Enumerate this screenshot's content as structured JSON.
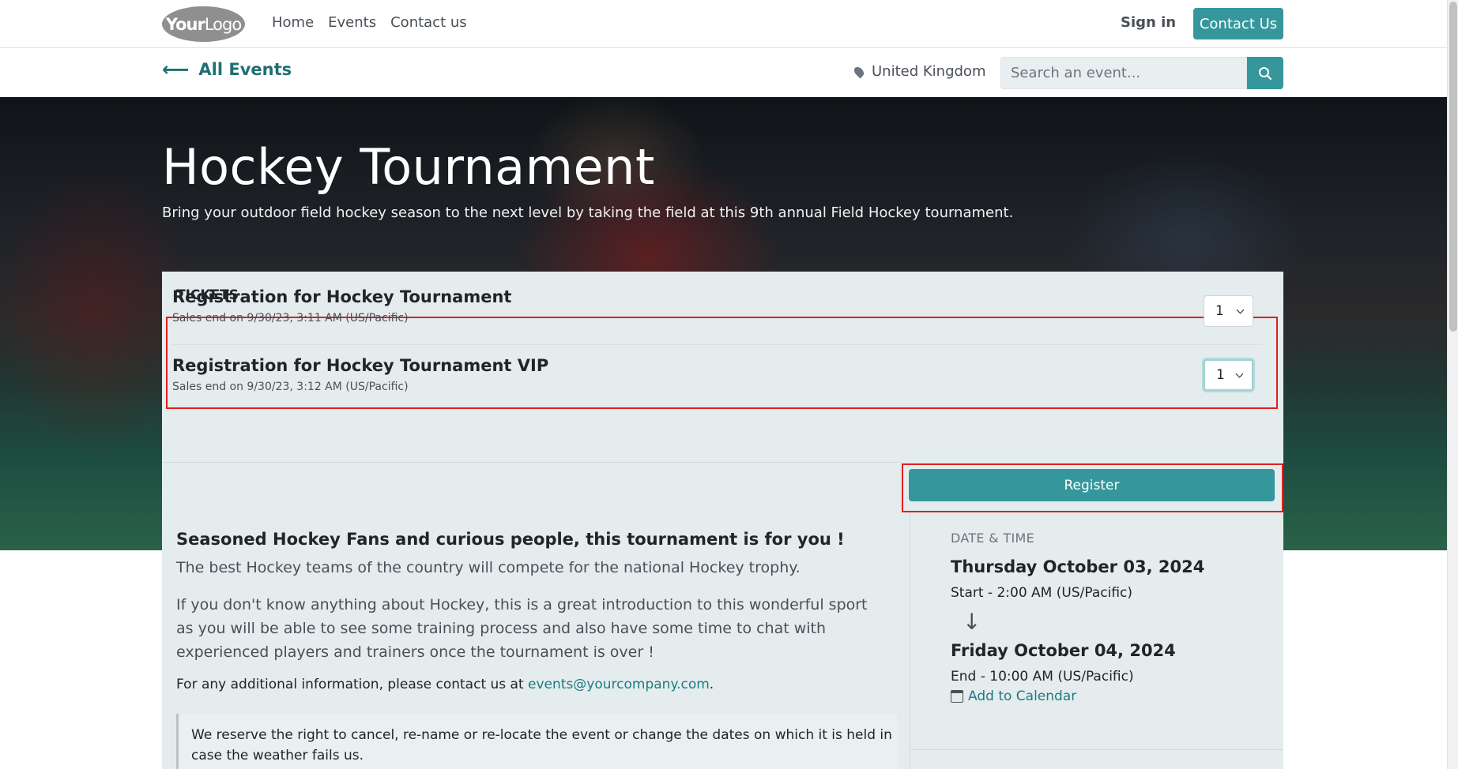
{
  "navbar": {
    "logo_bold": "Your",
    "logo_light": "Logo",
    "links": [
      "Home",
      "Events",
      "Contact us"
    ],
    "signin": "Sign in",
    "contact_button": "Contact Us"
  },
  "subbar": {
    "back_link": "All Events",
    "location": "United Kingdom",
    "search_placeholder": "Search an event..."
  },
  "hero": {
    "title": "Hockey Tournament",
    "subtitle": "Bring your outdoor field hockey season to the next level by taking the field at this 9th annual Field Hockey tournament."
  },
  "tickets": {
    "heading": "TICKETS",
    "items": [
      {
        "name": "Registration for Hockey Tournament",
        "sales_end": "Sales end on 9/30/23, 3:11 AM (US/Pacific)",
        "quantity": "1"
      },
      {
        "name": "Registration for Hockey Tournament VIP",
        "sales_end": "Sales end on 9/30/23, 3:12 AM (US/Pacific)",
        "quantity": "1"
      }
    ],
    "register_button": "Register"
  },
  "description": {
    "heading": "Seasoned Hockey Fans and curious people, this tournament is for you !",
    "p1": "The best Hockey teams of the country will compete for the national Hockey trophy.",
    "p2": "If you don't know anything about Hockey, this is a great introduction to this wonderful sport as you will be able to see some training process and also have some time to chat with experienced players and trainers once the tournament is over !",
    "p3_prefix": "For any additional information, please contact us at ",
    "p3_email": "events@yourcompany.com",
    "p3_suffix": ".",
    "quote": "We reserve the right to cancel, re-name or re-locate the event or change the dates on which it is held in case the weather fails us."
  },
  "datetime": {
    "label": "DATE & TIME",
    "start_date": "Thursday October 03, 2024",
    "start_time": "Start - 2:00 AM (US/Pacific)",
    "end_date": "Friday October 04, 2024",
    "end_time": "End - 10:00 AM (US/Pacific)",
    "add_to_calendar": "Add to Calendar"
  },
  "colors": {
    "primary": "#35979c",
    "highlight": "#e02020",
    "card_bg": "#e4ecee"
  }
}
